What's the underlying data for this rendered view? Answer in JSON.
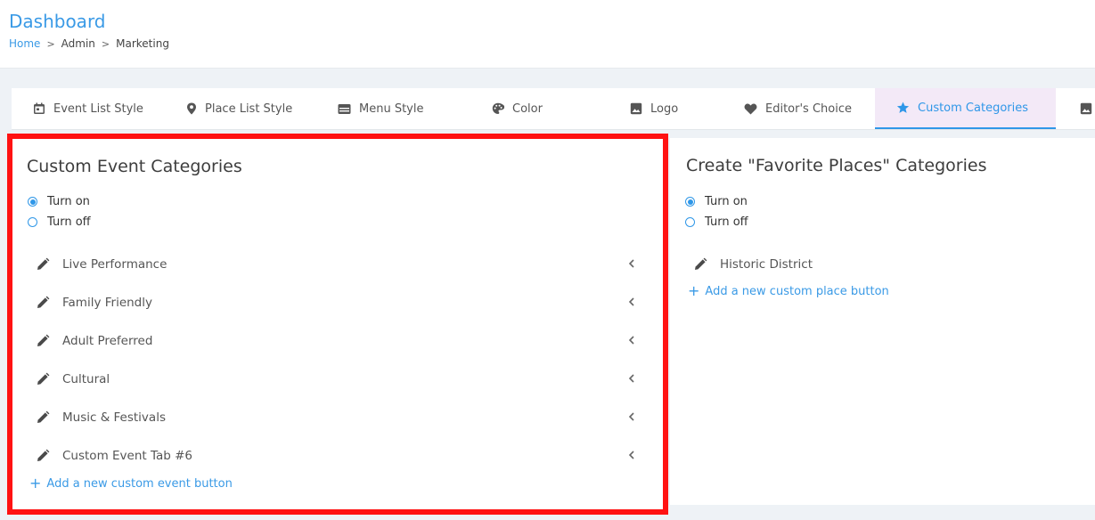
{
  "header": {
    "title": "Dashboard",
    "breadcrumb": [
      "Home",
      "Admin",
      "Marketing"
    ],
    "separator": ">"
  },
  "tabs": [
    {
      "label": "Event List Style",
      "icon": "calendar-icon"
    },
    {
      "label": "Place List Style",
      "icon": "map-pin-icon"
    },
    {
      "label": "Menu Style",
      "icon": "menu-card-icon"
    },
    {
      "label": "Color",
      "icon": "palette-icon"
    },
    {
      "label": "Logo",
      "icon": "image-icon"
    },
    {
      "label": "Editor's Choice",
      "icon": "heart-icon"
    },
    {
      "label": "Custom Categories",
      "icon": "star-icon",
      "active": true
    },
    {
      "label": "",
      "icon": "image-icon"
    }
  ],
  "event_panel": {
    "title": "Custom Event Categories",
    "radio_on": "Turn on",
    "radio_off": "Turn off",
    "selected": "Turn on",
    "categories": [
      "Live Performance",
      "Family Friendly",
      "Adult Preferred",
      "Cultural",
      "Music & Festivals",
      "Custom Event Tab #6"
    ],
    "add_label": "Add a new custom event button"
  },
  "place_panel": {
    "title": "Create \"Favorite Places\" Categories",
    "radio_on": "Turn on",
    "radio_off": "Turn off",
    "selected": "Turn on",
    "categories": [
      "Historic District"
    ],
    "add_label": "Add a new custom place button"
  },
  "colors": {
    "accent": "#2f97e8",
    "highlight_border": "#ff1212",
    "active_tab_bg": "#f3e9f7"
  }
}
